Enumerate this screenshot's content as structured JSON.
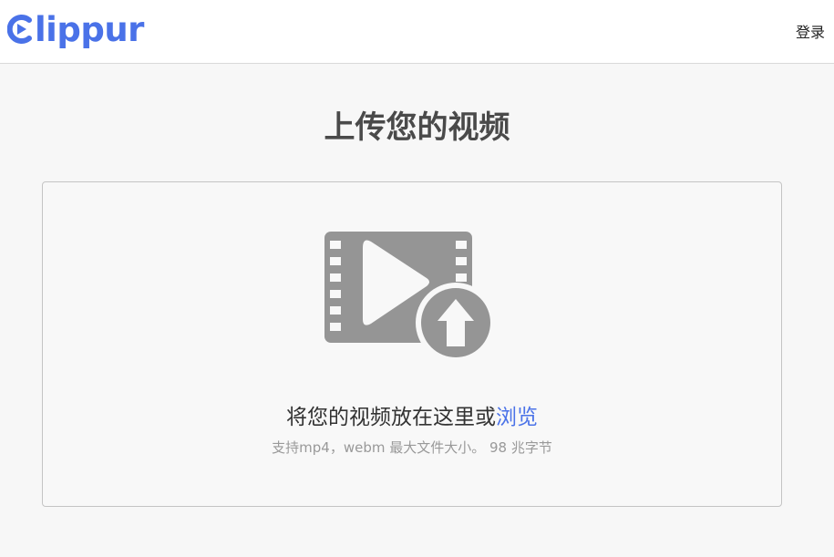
{
  "header": {
    "logo_text": "lippur",
    "login_label": "登录"
  },
  "main": {
    "title": "上传您的视频",
    "dropzone": {
      "prompt": "将您的视频放在这里或",
      "browse_label": "浏览",
      "hint": "支持mp4，webm 最大文件大小。 98 兆字节"
    }
  },
  "icons": {
    "logo": "play-c-logo-icon",
    "upload": "video-upload-icon"
  },
  "colors": {
    "brand": "#4a72e8",
    "icon_gray": "#959595",
    "title": "#4a4a4a",
    "hint": "#999999",
    "background": "#f7f7f7"
  }
}
